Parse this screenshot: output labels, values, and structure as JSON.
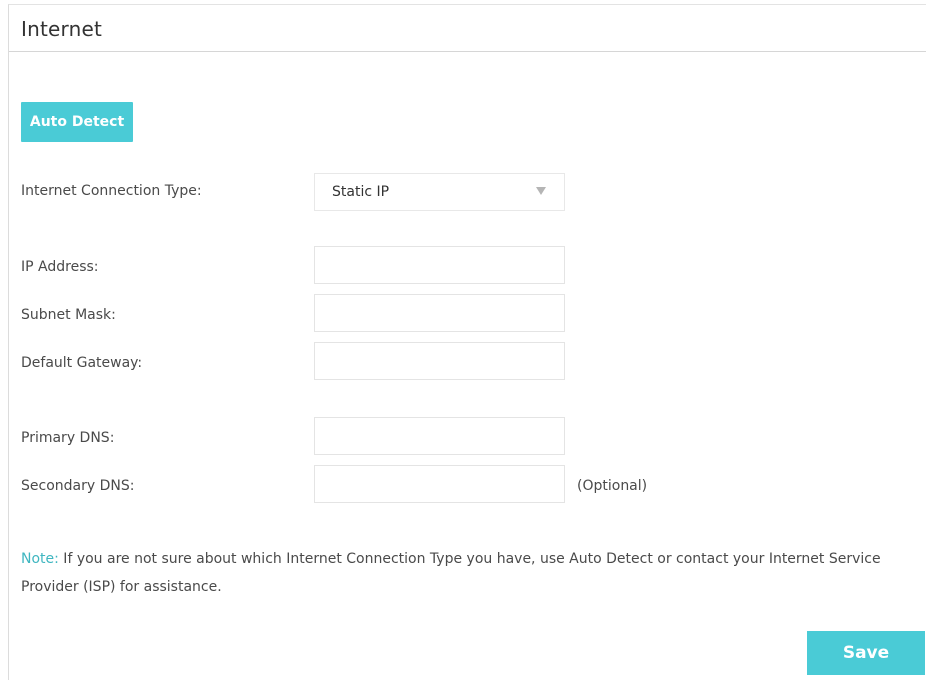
{
  "header": {
    "title": "Internet"
  },
  "toolbar": {
    "auto_detect_label": "Auto Detect",
    "save_label": "Save"
  },
  "form": {
    "connection_type": {
      "label": "Internet Connection Type:",
      "selected": "Static IP"
    },
    "ip_address": {
      "label": "IP Address:",
      "value": ""
    },
    "subnet_mask": {
      "label": "Subnet Mask:",
      "value": ""
    },
    "default_gateway": {
      "label": "Default Gateway:",
      "value": ""
    },
    "primary_dns": {
      "label": "Primary DNS:",
      "value": ""
    },
    "secondary_dns": {
      "label": "Secondary DNS:",
      "value": "",
      "hint": "(Optional)"
    }
  },
  "note": {
    "label": "Note:",
    "text": " If you are not sure about which Internet Connection Type you have, use Auto Detect or contact your Internet Service Provider (ISP) for assistance."
  },
  "colors": {
    "accent": "#4acbd6",
    "note_label": "#3fb6c0"
  },
  "icons": {
    "select_caret": "caret-down-icon"
  }
}
